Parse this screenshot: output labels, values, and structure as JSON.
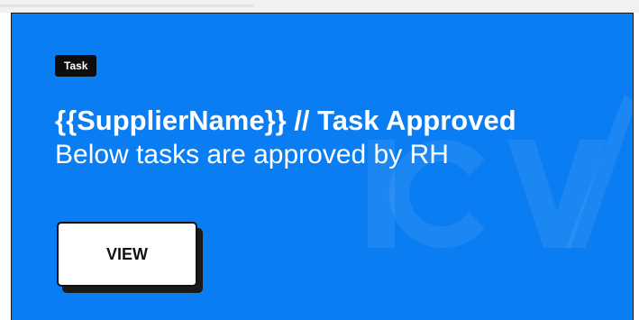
{
  "banner": {
    "badge": "Task",
    "title": "{{SupplierName}} // Task Approved",
    "subtitle": "Below tasks are approved by RH",
    "view_label": "VIEW",
    "watermark_icon": "icw-checkmark-logo"
  },
  "colors": {
    "background": "#0b7df3",
    "badge_background": "#0d0d0d",
    "text": "#ffffff",
    "button_background": "#ffffff",
    "button_text": "#111111"
  }
}
